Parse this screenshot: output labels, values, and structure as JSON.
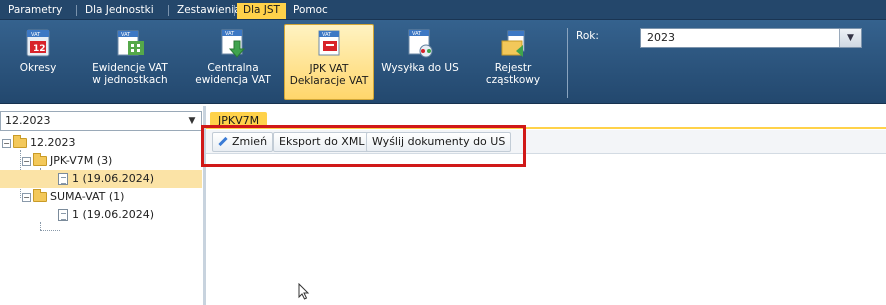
{
  "menu": {
    "items": [
      {
        "label": "Parametry",
        "active": false
      },
      {
        "label": "Dla Jednostki",
        "active": false
      },
      {
        "label": "Zestawienia",
        "active": false
      },
      {
        "label": "Dla JST",
        "active": true
      },
      {
        "label": "Pomoc",
        "active": false
      }
    ]
  },
  "ribbon": {
    "buttons": [
      {
        "label": "Okresy",
        "icon": "calendar-vat-icon",
        "active": false
      },
      {
        "label": "Ewidencje VAT\nw jednostkach",
        "icon": "vat-records-icon",
        "active": false
      },
      {
        "label": "Centralna\newidencja VAT",
        "icon": "central-vat-icon",
        "active": false
      },
      {
        "label": "JPK VAT\nDeklaracje VAT",
        "icon": "jpk-vat-icon",
        "active": true
      },
      {
        "label": "Wysyłka do US",
        "icon": "send-to-us-icon",
        "active": false
      },
      {
        "label": "Rejestr\ncząstkowy",
        "icon": "partial-register-icon",
        "active": false
      }
    ],
    "year_label": "Rok:",
    "year_value": "2023"
  },
  "left": {
    "period_value": "12.2023",
    "tree": [
      {
        "label": "12.2023",
        "level": 0,
        "type": "folder",
        "selected": false
      },
      {
        "label": "JPK-V7M (3)",
        "level": 1,
        "type": "folder",
        "selected": false
      },
      {
        "label": "1 (19.06.2024)",
        "level": 2,
        "type": "doc",
        "selected": true
      },
      {
        "label": "SUMA-VAT (1)",
        "level": 1,
        "type": "folder",
        "selected": false
      },
      {
        "label": "1 (19.06.2024)",
        "level": 2,
        "type": "doc",
        "selected": false
      }
    ]
  },
  "right": {
    "tab_label": "JPKV7M",
    "toolbar": {
      "edit_label": "Zmień",
      "export_label": "Eksport do XML",
      "send_label": "Wyślij dokumenty do US"
    }
  },
  "colors": {
    "menubar": "#24476b",
    "ribbon": "#2b5680",
    "accent": "#ffd24a",
    "highlight": "#d01818",
    "selected_row": "#fbe3a6"
  }
}
